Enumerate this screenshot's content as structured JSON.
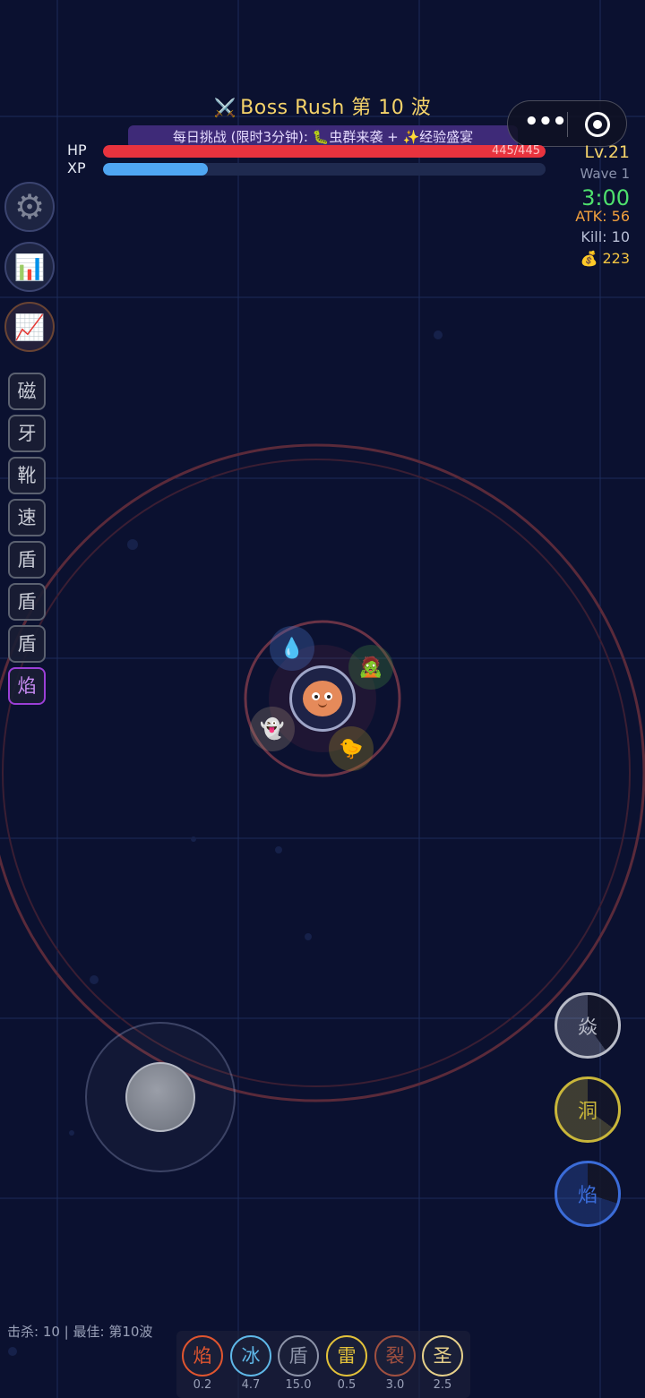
{
  "header": {
    "title_icon": "⚔️",
    "title": "Boss Rush  第 10 波",
    "challenge": "每日挑战 (限时3分钟): 🐛虫群来袭 + ✨经验盛宴"
  },
  "capsule": {
    "more_label": "•••",
    "close_icon": "target-icon"
  },
  "bars": {
    "hp_label": "HP",
    "hp_text": "445/445",
    "hp_fraction": 1.0,
    "xp_label": "XP",
    "xp_fraction": 0.237
  },
  "stats": {
    "level": "Lv.21",
    "wave": "Wave 1",
    "timer": "3:00",
    "atk": "ATK: 56",
    "kill": "Kill: 10",
    "gold": "💰 223"
  },
  "left_buttons": {
    "settings_icon": "⚙",
    "stats_icon": "📊",
    "trend_icon": "📈"
  },
  "tags": [
    "磁",
    "牙",
    "靴",
    "速",
    "盾",
    "盾",
    "盾",
    "焰"
  ],
  "orbs": {
    "water": "💧",
    "plant": "🧟",
    "ghost": "👻",
    "bee": "🐤"
  },
  "skills": [
    {
      "label": "焱",
      "color": "#b9bcc8",
      "fraction": 0.4
    },
    {
      "label": "洞",
      "color": "#c9b63a",
      "fraction": 0.35
    },
    {
      "label": "焰",
      "color": "#3b6cd8",
      "fraction": 0.3
    }
  ],
  "footer": {
    "text": "击杀: 10  |  最佳: 第10波",
    "elements": [
      {
        "label": "焰",
        "value": "0.2",
        "color": "#e0552f"
      },
      {
        "label": "冰",
        "value": "4.7",
        "color": "#5fb8e8"
      },
      {
        "label": "盾",
        "value": "15.0",
        "color": "#8c93a8"
      },
      {
        "label": "雷",
        "value": "0.5",
        "color": "#e3c23a"
      },
      {
        "label": "裂",
        "value": "3.0",
        "color": "#a05040"
      },
      {
        "label": "圣",
        "value": "2.5",
        "color": "#e6d08a"
      }
    ]
  },
  "colors": {
    "background": "#0b1130",
    "grid": "#1a2a55",
    "arena_ring": "#5a2a3a"
  }
}
